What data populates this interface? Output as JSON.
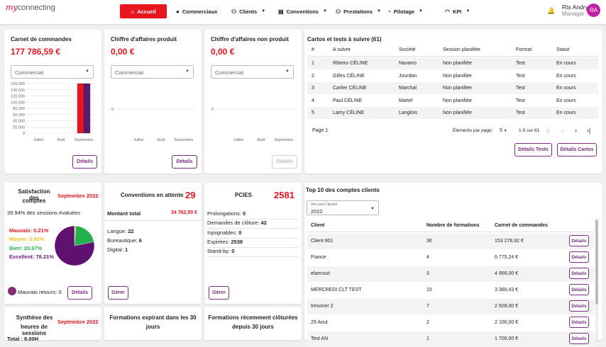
{
  "header": {
    "logo_my": "my",
    "logo_rest": "connecting",
    "nav": [
      {
        "label": "Accueil",
        "icon": "home-icon",
        "active": true
      },
      {
        "label": "Commerciaux",
        "icon": "person-icon"
      },
      {
        "label": "Clients",
        "icon": "group-icon"
      },
      {
        "label": "Conventions",
        "icon": "book-icon"
      },
      {
        "label": "Prestations",
        "icon": "group-icon"
      },
      {
        "label": "Pilotage",
        "icon": "gauge-icon"
      },
      {
        "label": "KPI",
        "icon": "wifi-icon"
      }
    ],
    "user_name": "Rts Andry",
    "user_role": "Manager",
    "avatar": "RA"
  },
  "carnet": {
    "title": "Carnet de commandes",
    "amount": "177 786,59 €",
    "select": "Commercial",
    "details": "Détails",
    "chart_data": {
      "type": "bar",
      "categories": [
        "Juillet",
        "Août",
        "Septembre"
      ],
      "series": [
        {
          "values": [
            0,
            0,
            177786.59
          ],
          "color": "#e8151f"
        },
        {
          "values": [
            0,
            0,
            177786.59
          ],
          "color": "#5a1a6b"
        }
      ],
      "ylim": [
        0,
        160000
      ],
      "yticks": [
        "160,000",
        "140,000",
        "120,000",
        "100,000",
        "80,000",
        "60,000",
        "40,000",
        "20,000",
        "0"
      ]
    }
  },
  "produit": {
    "title": "Chiffre d'affaires produit",
    "amount": "0,00 €",
    "select": "Commercial",
    "details": "Détails",
    "chart_data": {
      "type": "bar",
      "categories": [
        "Juillet",
        "Août",
        "Septembre"
      ],
      "values": [
        0,
        0,
        0
      ],
      "yticks": [
        "0"
      ]
    }
  },
  "nonproduit": {
    "title": "Chiffre d'affaires non produit",
    "amount": "0,00 €",
    "select": "Commercial",
    "details": "Détails",
    "chart_data": {
      "type": "bar",
      "categories": [
        "Juillet",
        "Août",
        "Septembre"
      ],
      "values": [
        0,
        0,
        0
      ],
      "yticks": [
        "0"
      ]
    }
  },
  "cartos": {
    "title": "Cartos et tests à suivre (61)",
    "headers": [
      "#",
      "A suivre",
      "Société",
      "Session planifiée",
      "Format",
      "Statut"
    ],
    "rows": [
      [
        "1",
        "Ribeiro CÉLINE",
        "Navarro",
        "Non planifiée",
        "Test",
        "En cours"
      ],
      [
        "2",
        "Gilles CÉLINE",
        "Jourdan",
        "Non planifiée",
        "Test",
        "En cours"
      ],
      [
        "3",
        "Carlier CÉLINE",
        "Marchal",
        "Non planifiée",
        "Test",
        "En cours"
      ],
      [
        "4",
        "Paul CÉLINE",
        "Martel",
        "Non planifiée",
        "Test",
        "En cours"
      ],
      [
        "5",
        "Lamy CÉLINE",
        "Langlois",
        "Non planifiée",
        "Test",
        "En cours"
      ]
    ],
    "page": "Page 1",
    "per_page_label": "Éléments par page:",
    "per_page": "5",
    "range": "1-5 sur 61",
    "btn_tests": "Détails Tests",
    "btn_cartos": "Détails Cartos"
  },
  "satisfaction": {
    "title1": "Satisfaction des",
    "title2": "comptes",
    "period": "Septembre 2022",
    "evaluated": "39.94% des sessions évaluées",
    "legend": [
      {
        "label": "Mauvais: 0.21%",
        "color": "#e8151f"
      },
      {
        "label": "Moyen: 0.91%",
        "color": "#f0c419"
      },
      {
        "label": "Bien: 20.67%",
        "color": "#22b14c"
      },
      {
        "label": "Excellent: 78.21%",
        "color": "#6b1d7a"
      }
    ],
    "chart_data": {
      "type": "pie",
      "labels": [
        "Mauvais",
        "Moyen",
        "Bien",
        "Excellent"
      ],
      "values": [
        0.21,
        0.91,
        20.67,
        78.21
      ],
      "colors": [
        "#e8151f",
        "#f0c419",
        "#22b14c",
        "#5e1170"
      ]
    },
    "bad_returns": "Mauvais retours: 0",
    "details": "Détails"
  },
  "conventions": {
    "title": "Conventions en attente",
    "count": "29",
    "total_label": "Montant total",
    "total_value": "34 762,50 €",
    "items": [
      {
        "label": "Langue: ",
        "value": "22"
      },
      {
        "label": "Bureautique: ",
        "value": "6"
      },
      {
        "label": "Digital: ",
        "value": "1"
      }
    ],
    "manage": "Gérer"
  },
  "pcies": {
    "title": "PCIES",
    "count": "2581",
    "items": [
      {
        "label": "Prolongations: ",
        "value": "0"
      },
      {
        "label": "Demandes de clôture: ",
        "value": "42"
      },
      {
        "label": "Injoignables: ",
        "value": "0"
      },
      {
        "label": "Expirées: ",
        "value": "2539"
      },
      {
        "label": "Stand-by: ",
        "value": "0"
      }
    ],
    "manage": "Gérer"
  },
  "top10": {
    "title": "Top 10 des comptes clients",
    "year_label": "Voir pour l'année",
    "year": "2022",
    "headers": [
      "Client",
      "Nombre de formations",
      "Carnet de commandes"
    ],
    "rows": [
      [
        "Client 801",
        "36",
        "153 276,92 €"
      ],
      [
        "France",
        "4",
        "6 775,24 €"
      ],
      [
        "elancout",
        "3",
        "4 956,00 €"
      ],
      [
        "MERCREDI CLT TEST",
        "15",
        "3 360,43 €"
      ],
      [
        "tresorier 2",
        "7",
        "2 928,00 €"
      ],
      [
        "29 Aout",
        "2",
        "2 100,00 €"
      ],
      [
        "Test AN",
        "1",
        "1 700,00 €"
      ]
    ],
    "details": "Détails"
  },
  "synthese": {
    "title1": "Synthèse des",
    "title2": "heures de sessions",
    "period": "Septembre 2022",
    "total": "Total : 8.00H"
  },
  "expirant": {
    "title1": "Formations expirant dans les 30",
    "title2": "jours"
  },
  "cloturees": {
    "title1": "Formations récemment clôturées",
    "title2": "depuis 30 jours"
  }
}
